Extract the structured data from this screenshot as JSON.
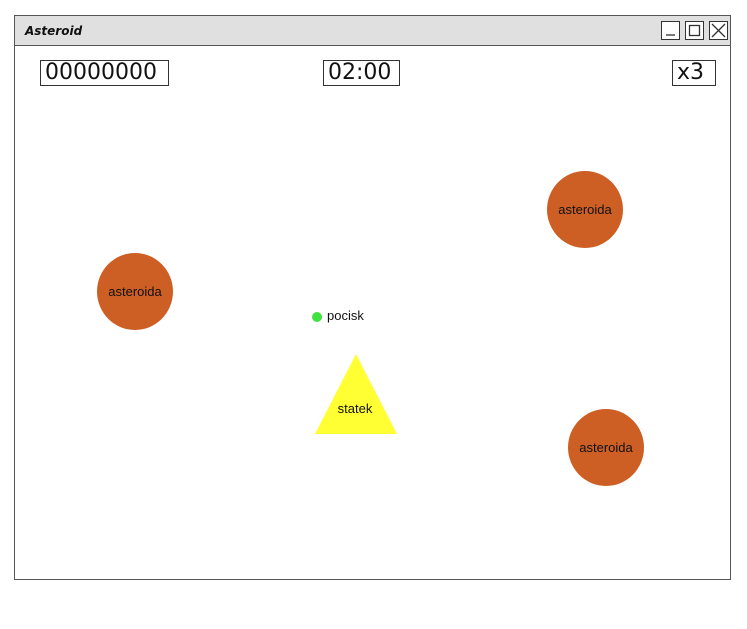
{
  "window": {
    "title": "Asteroid"
  },
  "hud": {
    "score": "00000000",
    "timer": "02:00",
    "lives": "x3"
  },
  "game": {
    "asteroids": [
      {
        "label": "asteroida"
      },
      {
        "label": "asteroida"
      },
      {
        "label": "asteroida"
      }
    ],
    "bullet": {
      "label": "pocisk"
    },
    "ship": {
      "label": "statek"
    }
  },
  "colors": {
    "asteroid": "#cd5f25",
    "bullet": "#3fe23f",
    "ship": "#ffff33",
    "titlebar": "#e0e0e0"
  },
  "icons": {
    "minimize": "minimize-icon",
    "maximize": "maximize-icon",
    "close": "close-icon"
  }
}
